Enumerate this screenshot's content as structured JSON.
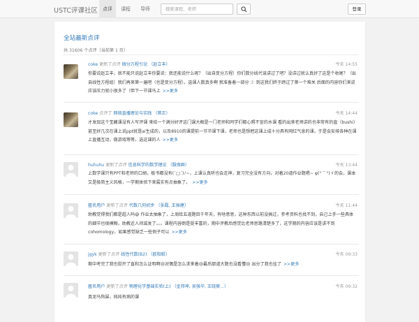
{
  "navbar": {
    "brand": "USTC评课社区",
    "links": [
      {
        "label": "点评",
        "active": true
      },
      {
        "label": "课程",
        "active": false
      },
      {
        "label": "导师",
        "active": false
      }
    ],
    "search_placeholder": "搜索课程、老师",
    "login_label": "登录"
  },
  "main": {
    "title": "全站最新点评",
    "count_text": "共 31606 个点评（当前第 1 页）",
    "more_label": ">>更多",
    "reviews": [
      {
        "user": "coke",
        "verb": "更新了点评",
        "course": "微分方程引论",
        "teachers": "（赵立丰）",
        "time": "今天 14:55",
        "avatar": "photo",
        "text": "你要说赵立丰，就不能只说赵立丰你要说：我还能说什么呢？（出自变分方程）你们数分线代该讲过了吧？没讲过就认真好了这是个收尾？（出自线性方程组）我们再来第一遍吧（也是变分方程）。选课人数真多啊 我准备着一部分 :）到这我们终于跨过了第一个难关 后面的内容你们来说应该压力就小很多了（但下一节课马上"
      },
      {
        "user": "coke",
        "verb": "点评了",
        "course": "网络直播理论与实践",
        "teachers": "（蒋正）",
        "time": "今天 14:44",
        "avatar": "photo",
        "text": "才发现这个宝藏课没有人写评课 来给一个满分好评这门课大概是一门老师和同学们都心照不宣的水课 看的出来老师讲的也非常有的直（bushi） 甚至好几次在课上说ppt就是ai生成的，以及8910的课提前一节节课下课，老师也是想把这课上成十分具有网红气息的课，于是会安排各种在课上直播互动，做游戏等等，选这课的人"
      },
      {
        "user": "huhuhu",
        "verb": "更新了点评",
        "course": "信息科学的数学理论",
        "teachers": "（殷保群）",
        "time": "今天 13:44",
        "avatar": "default",
        "text": "上数学课只有PPT和老师的口胡，板书都没有(`□´)ﾉ~，上课认真听也会走神，复习完全没有方向，对着20道作业题嗯~ φ(° ˘ °)ゞ的会，课本又是极简主义风格，一学期体验下来属实有点抽象了。"
      },
      {
        "user": "匿名用户",
        "verb": "更新了点评",
        "course": "代数几何初步",
        "teachers": "（张磊, 王振建）",
        "time": "今天 11:44",
        "avatar": "default",
        "text": "助教觉得我们都是超人吗😅 作业太抽象了，上周给五道题目千年天，有啥意思，这种东西以前没搞过，参考资料也找不到，自己上手一些具体的细节也很模糊，助教近人间滋发了。。。课程内容倒是挺丰富的，期中评教后感觉比老师思路清楚多了，这学期的内容应该是讲不到cohomology，如果感觉缺乏一些例子可以"
      },
      {
        "user": "jgyk",
        "verb": "更新了点评",
        "course": "线性代数(B2)",
        "teachers": "（欧阳毅）",
        "time": "今天 09:33",
        "avatar": "default",
        "text": "期中考完了我也挺开了直和怎么证明啊😢对偶是怎么求来着😢最后那道大题也没看懂😢 出分了我也挂了"
      },
      {
        "user": "匿名用户",
        "verb": "更新了点评",
        "course": "物理化学基础实验(上)",
        "teachers": "（金邦坤, 吴强华, 王晓葵...）",
        "time": "今天 09:32",
        "avatar": "default",
        "text": "真泥马狗屎，纯纯有病的课"
      }
    ]
  }
}
